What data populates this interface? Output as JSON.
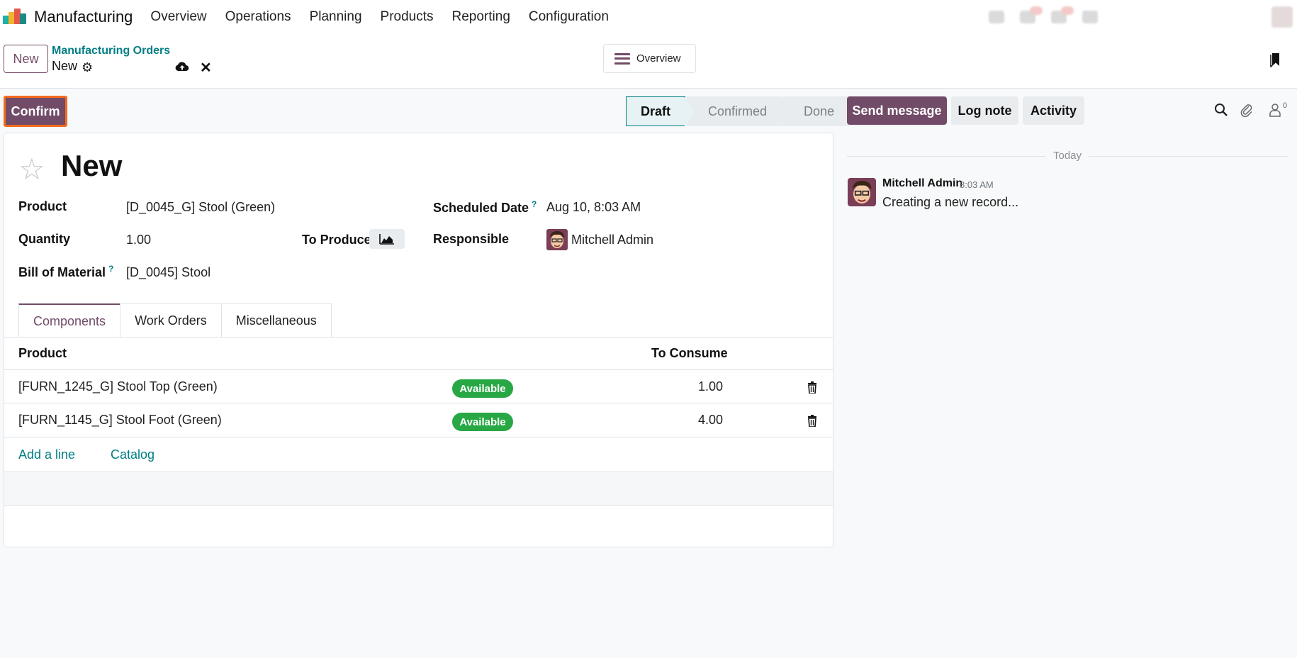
{
  "app": {
    "name": "Manufacturing"
  },
  "menu": [
    "Overview",
    "Operations",
    "Planning",
    "Products",
    "Reporting",
    "Configuration"
  ],
  "control": {
    "new_button": "New",
    "breadcrumb_parent": "Manufacturing Orders",
    "breadcrumb_current": "New",
    "overview_button": "Overview"
  },
  "statusbar": {
    "confirm_button": "Confirm",
    "stages": [
      {
        "label": "Draft",
        "active": true
      },
      {
        "label": "Confirmed",
        "active": false
      },
      {
        "label": "Done",
        "active": false
      }
    ]
  },
  "form": {
    "title": "New",
    "product_label": "Product",
    "product_value": "[D_0045_G] Stool (Green)",
    "quantity_label": "Quantity",
    "quantity_value": "1.00",
    "to_produce_label": "To Produce",
    "bom_label": "Bill of Material",
    "bom_value": "[D_0045] Stool",
    "scheduled_label": "Scheduled Date",
    "scheduled_value": "Aug 10, 8:03 AM",
    "responsible_label": "Responsible",
    "responsible_value": "Mitchell Admin",
    "help_mark": "?"
  },
  "tabs": [
    {
      "label": "Components",
      "active": true
    },
    {
      "label": "Work Orders",
      "active": false
    },
    {
      "label": "Miscellaneous",
      "active": false
    }
  ],
  "components": {
    "col_product": "Product",
    "col_to_consume": "To Consume",
    "rows": [
      {
        "product": "[FURN_1245_G] Stool Top (Green)",
        "status": "Available",
        "qty": "1.00"
      },
      {
        "product": "[FURN_1145_G] Stool Foot (Green)",
        "status": "Available",
        "qty": "4.00"
      }
    ],
    "add_line": "Add a line",
    "catalog": "Catalog"
  },
  "chatter": {
    "send_message": "Send message",
    "log_note": "Log note",
    "activity": "Activity",
    "followers_count": "0",
    "date_separator": "Today",
    "message": {
      "author": "Mitchell Admin",
      "time": "8:03 AM",
      "body": "Creating a new record..."
    }
  },
  "colors": {
    "brand": "#714b67",
    "link": "#017e84",
    "success": "#28a745",
    "highlight": "#f26b1d"
  }
}
